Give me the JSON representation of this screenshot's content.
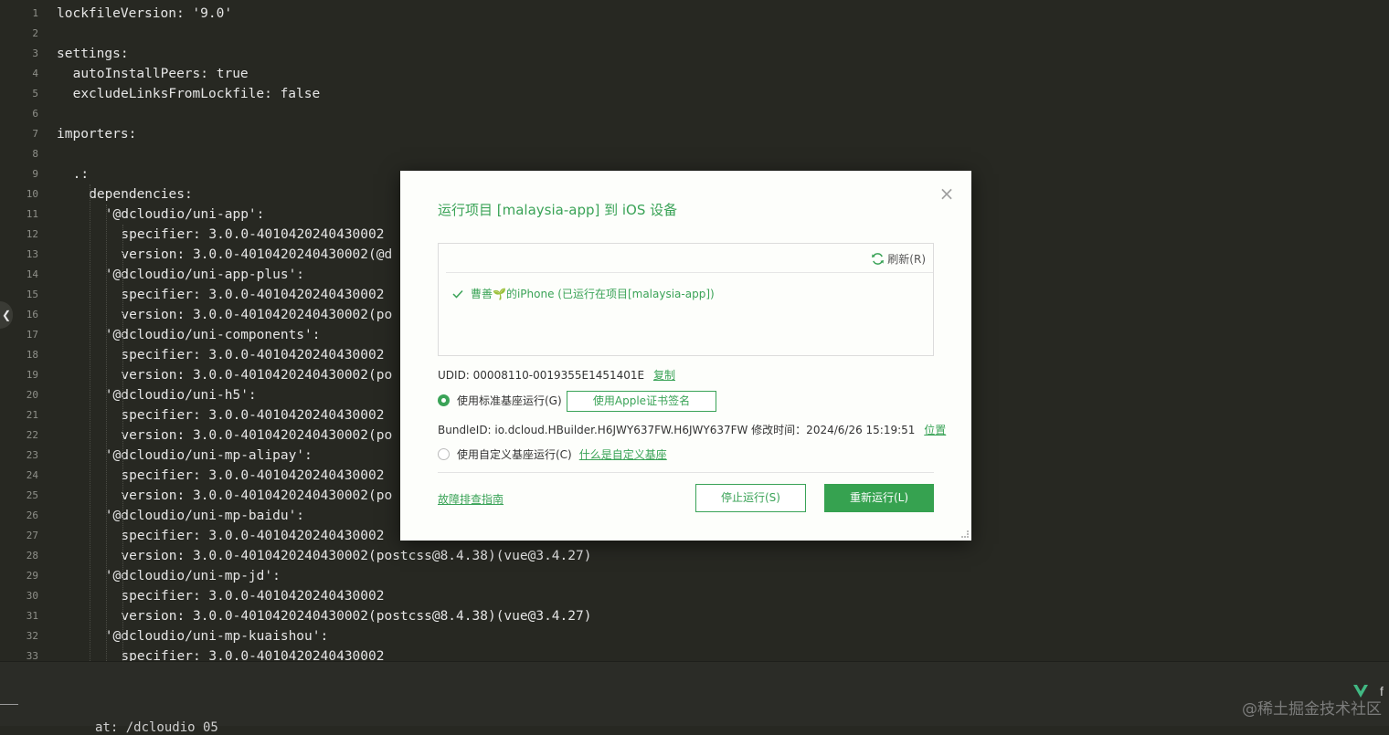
{
  "editor": {
    "lines": [
      {
        "n": "1",
        "indent": 0,
        "text": "lockfileVersion: '9.0'"
      },
      {
        "n": "2",
        "indent": 0,
        "text": ""
      },
      {
        "n": "3",
        "indent": 0,
        "text": "settings:"
      },
      {
        "n": "4",
        "indent": 2,
        "text": "autoInstallPeers: true"
      },
      {
        "n": "5",
        "indent": 2,
        "text": "excludeLinksFromLockfile: false"
      },
      {
        "n": "6",
        "indent": 0,
        "text": ""
      },
      {
        "n": "7",
        "indent": 0,
        "text": "importers:"
      },
      {
        "n": "8",
        "indent": 0,
        "text": ""
      },
      {
        "n": "9",
        "indent": 2,
        "text": ".:"
      },
      {
        "n": "10",
        "indent": 4,
        "text": "dependencies:"
      },
      {
        "n": "11",
        "indent": 6,
        "text": "'@dcloudio/uni-app':"
      },
      {
        "n": "12",
        "indent": 8,
        "text": "specifier: 3.0.0-4010420240430002"
      },
      {
        "n": "13",
        "indent": 8,
        "text": "version: 3.0.0-4010420240430002(@d"
      },
      {
        "n": "14",
        "indent": 6,
        "text": "'@dcloudio/uni-app-plus':"
      },
      {
        "n": "15",
        "indent": 8,
        "text": "specifier: 3.0.0-4010420240430002"
      },
      {
        "n": "16",
        "indent": 8,
        "text": "version: 3.0.0-4010420240430002(po"
      },
      {
        "n": "17",
        "indent": 6,
        "text": "'@dcloudio/uni-components':"
      },
      {
        "n": "18",
        "indent": 8,
        "text": "specifier: 3.0.0-4010420240430002"
      },
      {
        "n": "19",
        "indent": 8,
        "text": "version: 3.0.0-4010420240430002(po"
      },
      {
        "n": "20",
        "indent": 6,
        "text": "'@dcloudio/uni-h5':"
      },
      {
        "n": "21",
        "indent": 8,
        "text": "specifier: 3.0.0-4010420240430002"
      },
      {
        "n": "22",
        "indent": 8,
        "text": "version: 3.0.0-4010420240430002(po"
      },
      {
        "n": "23",
        "indent": 6,
        "text": "'@dcloudio/uni-mp-alipay':"
      },
      {
        "n": "24",
        "indent": 8,
        "text": "specifier: 3.0.0-4010420240430002"
      },
      {
        "n": "25",
        "indent": 8,
        "text": "version: 3.0.0-4010420240430002(po"
      },
      {
        "n": "26",
        "indent": 6,
        "text": "'@dcloudio/uni-mp-baidu':"
      },
      {
        "n": "27",
        "indent": 8,
        "text": "specifier: 3.0.0-4010420240430002"
      },
      {
        "n": "28",
        "indent": 8,
        "text": "version: 3.0.0-4010420240430002(postcss@8.4.38)(vue@3.4.27)"
      },
      {
        "n": "29",
        "indent": 6,
        "text": "'@dcloudio/uni-mp-jd':"
      },
      {
        "n": "30",
        "indent": 8,
        "text": "specifier: 3.0.0-4010420240430002"
      },
      {
        "n": "31",
        "indent": 8,
        "text": "version: 3.0.0-4010420240430002(postcss@8.4.38)(vue@3.4.27)"
      },
      {
        "n": "32",
        "indent": 6,
        "text": "'@dcloudio/uni-mp-kuaishou':"
      },
      {
        "n": "33",
        "indent": 8,
        "text": "specifier: 3.0.0-4010420240430002"
      }
    ]
  },
  "bottom": {
    "partial_text": "at: /dcloudio 05",
    "edge_char": "f",
    "watermark": "@稀土掘金技术社区"
  },
  "dialog": {
    "title": "运行项目 [malaysia-app] 到 iOS 设备",
    "close_glyph": "×",
    "refresh_label": "刷新(R)",
    "device_label": "曹善🌱的iPhone (已运行在项目[malaysia-app])",
    "udid_label": "UDID: 00008110-0019355E1451401E",
    "copy_link": "复制",
    "std_run_label": "使用标准基座运行(G)",
    "apple_sign_button": "使用Apple证书签名",
    "bundle_label": "BundleID:  io.dcloud.HBuilder.H6JWY637FW.H6JWY637FW  修改时间：2024/6/26 15:19:51",
    "location_link": "位置",
    "custom_run_label": "使用自定义基座运行(C)",
    "custom_help_link": "什么是自定义基座",
    "guide_link": "故障排查指南",
    "stop_button": "停止运行(S)",
    "rerun_button": "重新运行(L)"
  },
  "colors": {
    "accent": "#3aa357",
    "editor_bg": "#272822",
    "dialog_bg": "#fdfefb"
  }
}
